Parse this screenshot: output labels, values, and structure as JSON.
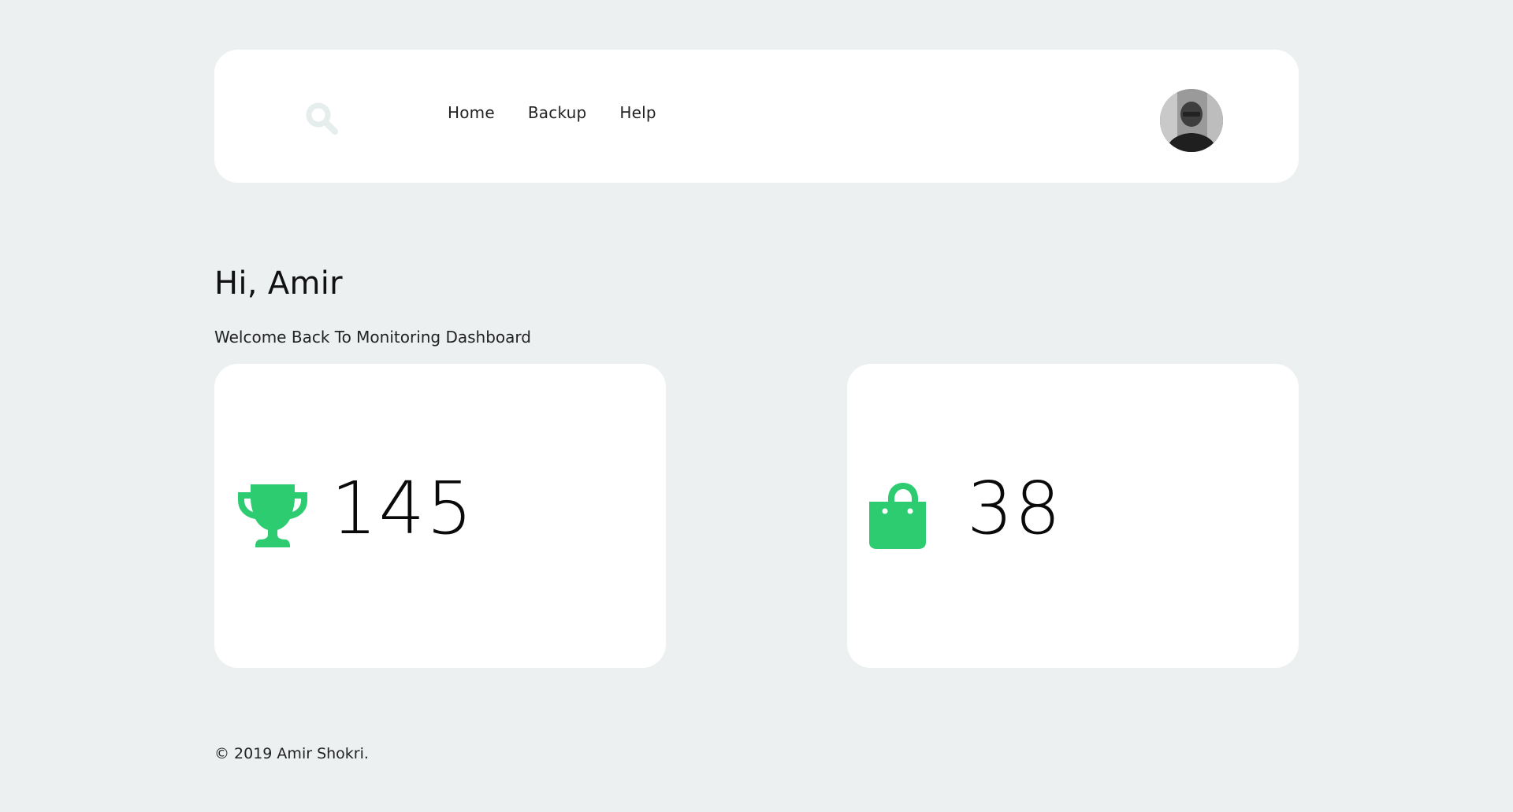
{
  "header": {
    "search_icon": "search-icon",
    "nav": [
      {
        "label": "Home"
      },
      {
        "label": "Backup"
      },
      {
        "label": "Help"
      }
    ],
    "avatar_icon": "user-avatar"
  },
  "main": {
    "greeting": "Hi, Amir",
    "subtitle": "Welcome Back To Monitoring Dashboard",
    "cards": [
      {
        "icon": "trophy-icon",
        "value": "145",
        "accent": "#2ecc71"
      },
      {
        "icon": "shopping-bag-icon",
        "value": "38",
        "accent": "#2ecc71"
      }
    ]
  },
  "footer": {
    "copyright": "© 2019 Amir Shokri."
  },
  "colors": {
    "background": "#ecf0f1",
    "card": "#ffffff",
    "accent": "#2ecc71",
    "search_icon": "#e8eeee"
  }
}
